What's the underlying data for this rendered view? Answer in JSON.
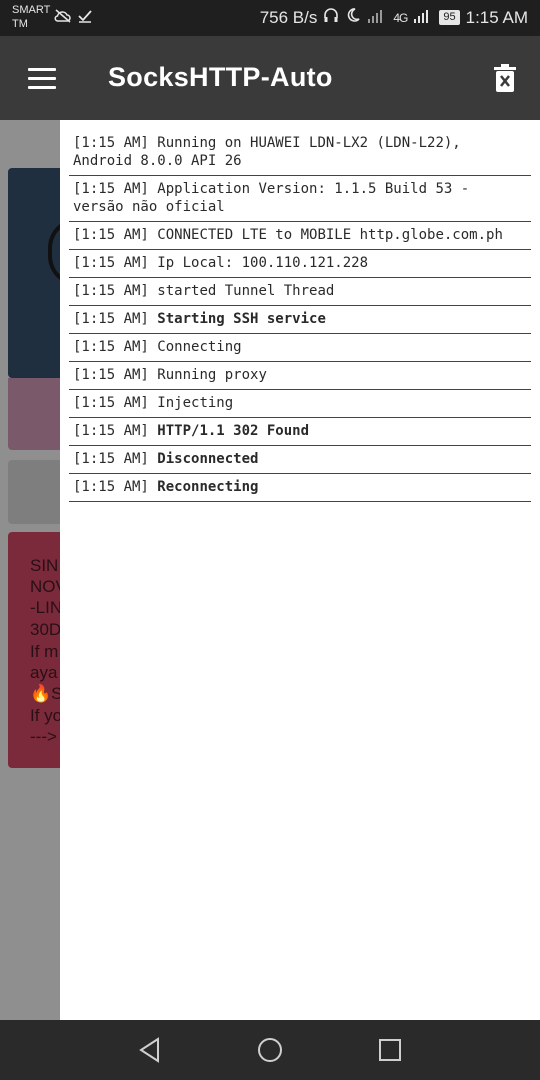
{
  "status_bar": {
    "carrier_line1": "SMART",
    "carrier_line2": "TM",
    "left_icons": [
      "cloud-off-icon",
      "check-icon"
    ],
    "speed": "756 B/s",
    "network_label": "4G",
    "battery": "95",
    "time": "1:15 AM"
  },
  "toolbar": {
    "title": "SocksHTTP-Auto",
    "menu_icon": "hamburger-icon",
    "clear_icon": "trash-icon"
  },
  "background": {
    "card3_lines": [
      "SIN",
      "NOV",
      "-LIN",
      "30D",
      "If m",
      "aya",
      "🔥S",
      "If yo",
      "--->"
    ]
  },
  "log": {
    "entries": [
      {
        "time": "[1:15 AM]",
        "message": "Running on HUAWEI LDN-LX2 (LDN-L22), Android 8.0.0 API 26",
        "bold": false
      },
      {
        "time": "[1:15 AM]",
        "message": "Application Version: 1.1.5 Build 53 - versão não oficial",
        "bold": false
      },
      {
        "time": "[1:15 AM]",
        "message": "CONNECTED LTE to MOBILE http.globe.com.ph",
        "bold": false
      },
      {
        "time": "[1:15 AM]",
        "message": "Ip Local: 100.110.121.228",
        "bold": false
      },
      {
        "time": "[1:15 AM]",
        "message": "started Tunnel Thread",
        "bold": false
      },
      {
        "time": "[1:15 AM]",
        "message": "Starting SSH service",
        "bold": true
      },
      {
        "time": "[1:15 AM]",
        "message": "Connecting",
        "bold": false
      },
      {
        "time": "[1:15 AM]",
        "message": "Running proxy",
        "bold": false
      },
      {
        "time": "[1:15 AM]",
        "message": "Injecting",
        "bold": false
      },
      {
        "time": "[1:15 AM]",
        "message": "HTTP/1.1 302 Found",
        "bold": true
      },
      {
        "time": "[1:15 AM]",
        "message": "Disconnected",
        "bold": true
      },
      {
        "time": "[1:15 AM]",
        "message": "Reconnecting",
        "bold": true
      }
    ]
  },
  "nav": {
    "back": "back-icon",
    "home": "home-icon",
    "recents": "recents-icon"
  }
}
